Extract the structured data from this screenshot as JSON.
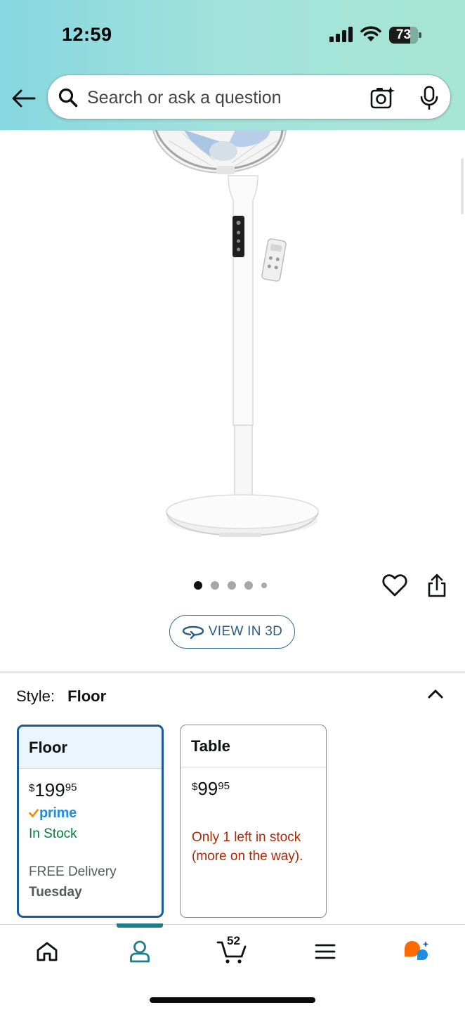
{
  "status_bar": {
    "time": "12:59",
    "battery_level": "73",
    "battery_fraction": 0.73
  },
  "search": {
    "placeholder": "Search or ask a question"
  },
  "gallery": {
    "image_count": 5,
    "active_index": 0,
    "view_3d_label": "VIEW IN 3D"
  },
  "style": {
    "label": "Style:",
    "selected_value": "Floor",
    "options": [
      {
        "name": "Floor",
        "price_symbol": "$",
        "price_whole": "199",
        "price_fraction": "95",
        "prime": "prime",
        "availability": "In Stock",
        "delivery_label": "FREE Delivery",
        "delivery_day": "Tuesday",
        "selected": true
      },
      {
        "name": "Table",
        "price_symbol": "$",
        "price_whole": "99",
        "price_fraction": "95",
        "availability": "Only 1 left in stock (more on the way).",
        "selected": false
      }
    ]
  },
  "bottom_nav": {
    "cart_count": "52",
    "items": [
      "home-icon",
      "you-icon",
      "cart-icon",
      "menu-icon",
      "rufus-icon"
    ],
    "active": "you-icon"
  },
  "colors": {
    "header_gradient_start": "#86d7e0",
    "header_gradient_end": "#a6e6d2",
    "selected_border": "#1a5a99",
    "in_stock": "#067d34",
    "low_stock": "#b12704",
    "prime_blue": "#1f8ce0",
    "prime_check": "#f08804",
    "nav_active": "#1b7e8c",
    "rufus_orange": "#ff6a00",
    "rufus_blue": "#1a8fe3"
  }
}
